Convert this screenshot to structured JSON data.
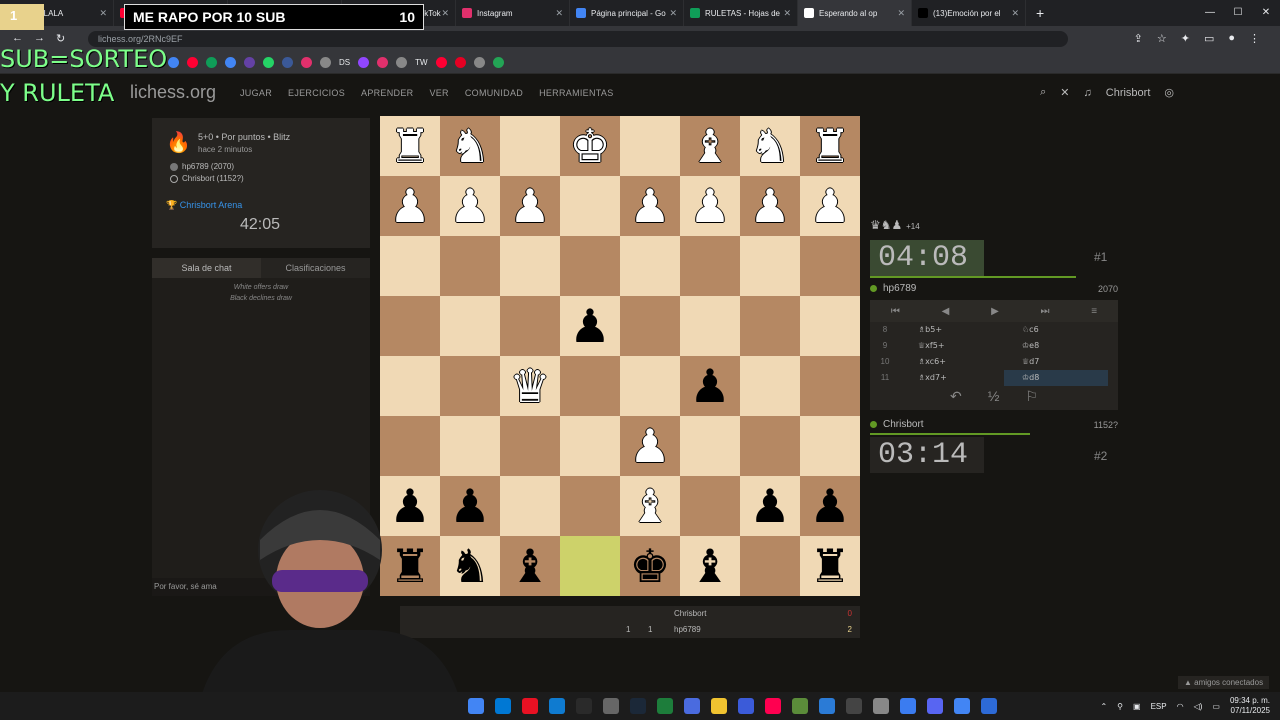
{
  "browser": {
    "tabs": [
      {
        "label": "R - LALALA",
        "color": "#e8d28c"
      },
      {
        "label": "",
        "color": "#ff0033"
      },
      {
        "label": "(4) WhatsApp",
        "color": "#25d366"
      },
      {
        "label": "(13)Mensajes | TikTok",
        "color": "#000000"
      },
      {
        "label": "Instagram",
        "color": "#e1306c"
      },
      {
        "label": "Página principal - Go",
        "color": "#4285f4"
      },
      {
        "label": "RULETAS - Hojas de",
        "color": "#0f9d58"
      },
      {
        "label": "Esperando al op",
        "color": "#ffffff"
      },
      {
        "label": "(13)Emoción por el",
        "color": "#000000"
      }
    ],
    "url": "lichess.org/2RNc9EF",
    "bookmarks": [
      "DS",
      "TW"
    ]
  },
  "overlay": {
    "counter": "1",
    "banner_text": "ME RAPO POR 10 SUB",
    "banner_count": "10",
    "sorteo_line1": "SUB=SORTEO",
    "sorteo_line2": "Y RULETA"
  },
  "site": {
    "logo": "lichess.org",
    "nav": [
      "JUGAR",
      "EJERCICIOS",
      "APRENDER",
      "VER",
      "COMUNIDAD",
      "HERRAMIENTAS"
    ],
    "username": "Chrisbort"
  },
  "game_info": {
    "line1": "5+0 • Por puntos • Blitz",
    "line2": "hace 2 minutos",
    "player_black": "hp6789 (2070)",
    "player_white": "Chrisbort (1152?)",
    "arena": "Chrisbort Arena",
    "arena_clock": "42:05"
  },
  "chat": {
    "tab_chat": "Sala de chat",
    "tab_standings": "Clasificaciones",
    "messages": [
      "White offers draw",
      "Black declines draw"
    ],
    "placeholder": "Por favor, sé ama"
  },
  "board": {
    "highlight": [
      7,
      3
    ],
    "rows": [
      [
        "wR",
        "wN",
        "",
        "wK",
        "",
        "wB",
        "wN",
        "wR"
      ],
      [
        "wP",
        "wP",
        "wP",
        "",
        "wP",
        "wP",
        "wP",
        "wP"
      ],
      [
        "",
        "",
        "",
        "",
        "",
        "",
        "",
        ""
      ],
      [
        "",
        "",
        "",
        "bP",
        "",
        "",
        "",
        ""
      ],
      [
        "",
        "",
        "wQ",
        "",
        "",
        "bP",
        "",
        ""
      ],
      [
        "",
        "",
        "",
        "",
        "wP",
        "",
        "",
        ""
      ],
      [
        "bP",
        "bP",
        "",
        "",
        "wB",
        "",
        "bP",
        "bP"
      ],
      [
        "bR",
        "bN",
        "bB",
        "",
        "bK",
        "bB",
        "",
        "bR"
      ]
    ],
    "glyphs": {
      "K": "♚",
      "Q": "♛",
      "R": "♜",
      "B": "♝",
      "N": "♞",
      "P": "♟"
    }
  },
  "opponent": {
    "captured": "♛♞♟",
    "captured_diff": "+14",
    "clock": "04:08",
    "rank": "#1",
    "name": "hp6789",
    "rating": "2070"
  },
  "moves": [
    {
      "n": "8",
      "w": "♗b5+",
      "b": "♘c6"
    },
    {
      "n": "9",
      "w": "♕xf5+",
      "b": "♔e8"
    },
    {
      "n": "10",
      "w": "♗xc6+",
      "b": "♕d7"
    },
    {
      "n": "11",
      "w": "♗xd7+",
      "b": "♔d8"
    }
  ],
  "move_controls": [
    "⏮",
    "◀",
    "▶",
    "⏭",
    "≡"
  ],
  "move_actions": [
    "↶",
    "½",
    "⚐"
  ],
  "player": {
    "name": "Chrisbort",
    "rating": "1152?",
    "clock": "03:14",
    "rank": "#2"
  },
  "scoreboard": [
    {
      "name": "Chrisbort",
      "r1": "",
      "r2": "",
      "pts": "0"
    },
    {
      "name": "hp6789",
      "r1": "1",
      "r2": "1",
      "pts": "2"
    }
  ],
  "friends": "amigos conectados",
  "taskbar": {
    "lang": "ESP",
    "time": "09:34 p. m.",
    "date": "07/11/2025"
  },
  "colors": {
    "accent_green": "#629924",
    "arena_blue": "#3692e7",
    "board_light": "#f0d9b5",
    "board_dark": "#b58863",
    "highlight": "#cdd26a"
  }
}
